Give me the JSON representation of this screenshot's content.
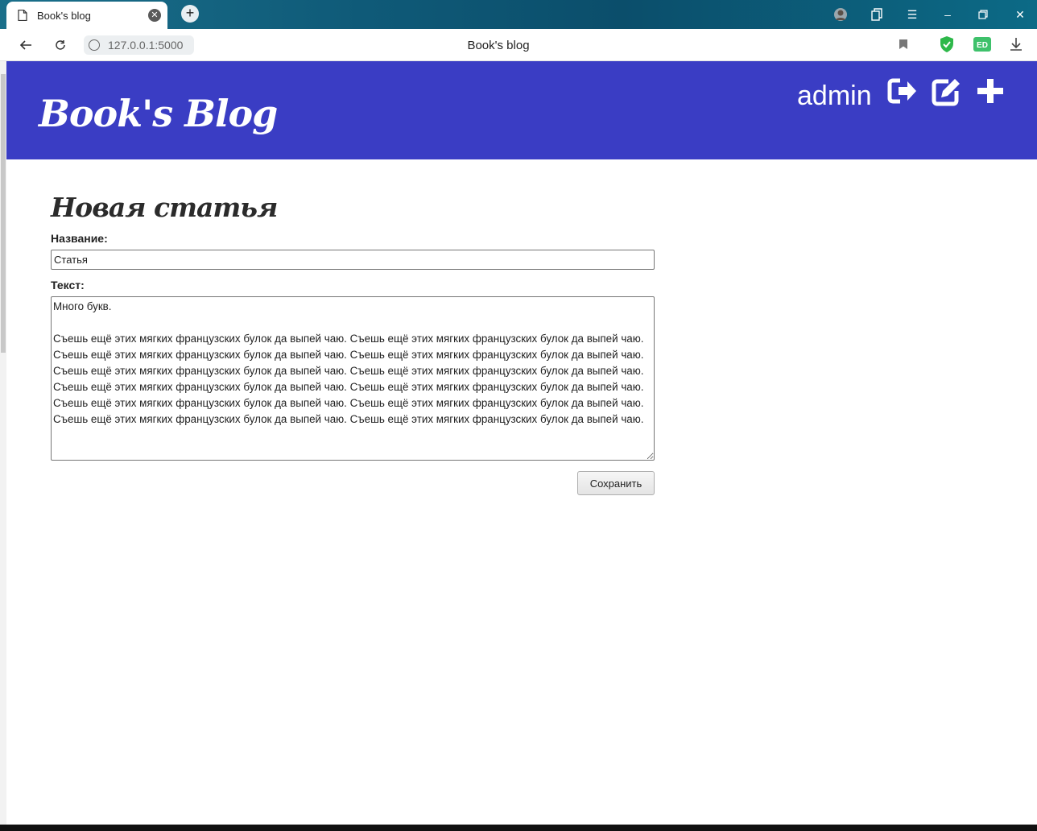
{
  "browser": {
    "tab_title": "Book's blog",
    "url": "127.0.0.1:5000",
    "window_title": "Book's blog"
  },
  "site": {
    "logo": "Book's Blog",
    "username": "admin",
    "header_color": "#3a3dc4"
  },
  "form": {
    "heading": "Новая статья",
    "title_label": "Название:",
    "title_value": "Статья",
    "text_label": "Текст:",
    "text_value": "Много букв.\n\nСъешь ещё этих мягких французских булок да выпей чаю. Съешь ещё этих мягких французских булок да выпей чаю. Съешь ещё этих мягких французских булок да выпей чаю. Съешь ещё этих мягких французских булок да выпей чаю. Съешь ещё этих мягких французских булок да выпей чаю. Съешь ещё этих мягких французских булок да выпей чаю. Съешь ещё этих мягких французских булок да выпей чаю. Съешь ещё этих мягких французских булок да выпей чаю. Съешь ещё этих мягких французских булок да выпей чаю. Съешь ещё этих мягких французских булок да выпей чаю. Съешь ещё этих мягких французских булок да выпей чаю. Съешь ещё этих мягких французских булок да выпей чаю.",
    "save_label": "Сохранить"
  },
  "icons": {
    "logout": "sign-out-icon",
    "edit": "edit-icon",
    "add": "plus-icon"
  }
}
